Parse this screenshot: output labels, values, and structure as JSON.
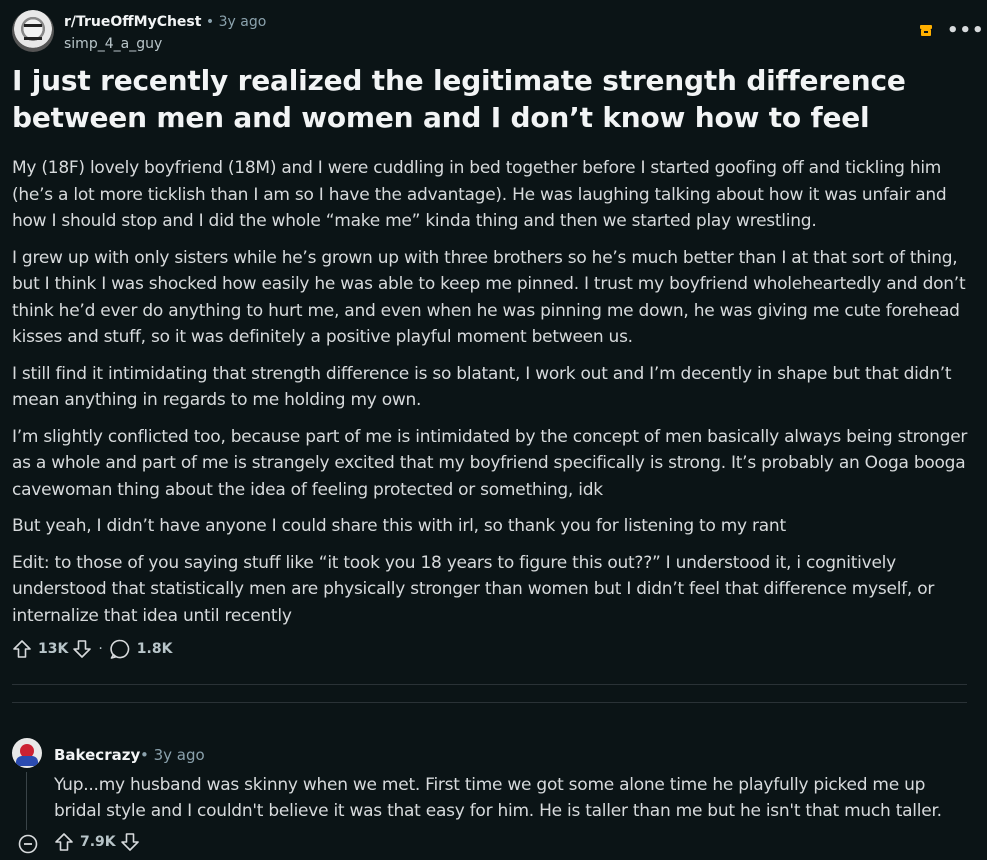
{
  "post": {
    "subreddit": "r/TrueOffMyChest",
    "time": "• 3y ago",
    "author": "simp_4_a_guy",
    "title": "I just recently realized the legitimate strength difference between men and women and I don’t know how to feel",
    "paragraphs": [
      "My (18F) lovely boyfriend (18M) and I were cuddling in bed together before I started goofing off and tickling him (he’s a lot more ticklish than I am so I have the advantage). He was laughing talking about how it was unfair and how I should stop and I did the whole “make me” kinda thing and then we started play wrestling.",
      "I grew up with only sisters while he’s grown up with three brothers so he’s much better than I at that sort of thing, but I think I was shocked how easily he was able to keep me pinned. I trust my boyfriend wholeheartedly and don’t think he’d ever do anything to hurt me, and even when he was pinning me down, he was giving me cute forehead kisses and stuff, so it was definitely a positive playful moment between us.",
      "I still find it intimidating that strength difference is so blatant, I work out and I’m decently in shape but that didn’t mean anything in regards to me holding my own.",
      "I’m slightly conflicted too, because part of me is intimidated by the concept of men basically always being stronger as a whole and part of me is strangely excited that my boyfriend specifically is strong. It’s probably an Ooga booga cavewoman thing about the idea of feeling protected or something, idk",
      "But yeah, I didn’t have anyone I could share this with irl, so thank you for listening to my rant",
      "Edit: to those of you saying stuff like “it took you 18 years to figure this out??” I understood it, i cognitively understood that statistically men are physically stronger than women but I didn’t feel that difference myself, or internalize that idea until recently"
    ],
    "upvotes": "13K",
    "separator": "·",
    "comments": "1.8K"
  },
  "comment": {
    "author": "Bakecrazy",
    "time": "• 3y ago",
    "text": "Yup...my husband was skinny when we met. First time we got some alone time he playfully picked me up bridal style and I couldn't believe it was that easy for him. He is taller than me but he isn't that much taller.",
    "upvotes": "7.9K"
  },
  "icons": {
    "archive": "archive-icon",
    "more": "more-options-icon",
    "upvote": "upvote-arrow-icon",
    "downvote": "downvote-arrow-icon",
    "comment": "comment-bubble-icon",
    "collapse": "collapse-minus-icon"
  },
  "colors": {
    "background": "#0b1416",
    "text": "#d7dadc",
    "muted": "#8ba2ad",
    "archive_accent": "#ffb000"
  }
}
